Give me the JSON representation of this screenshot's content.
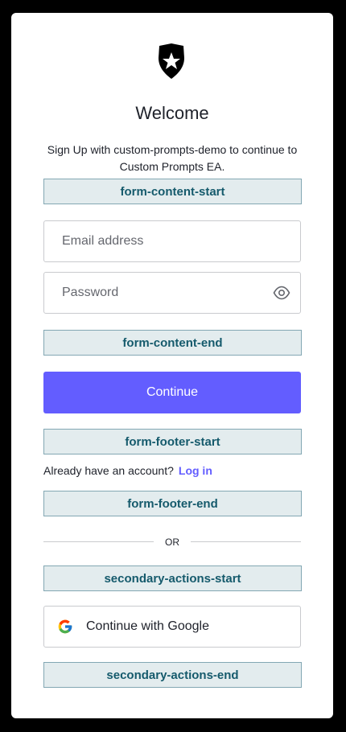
{
  "header": {
    "title": "Welcome",
    "subtitle": "Sign Up with custom-prompts-demo to continue to Custom Prompts EA."
  },
  "markers": {
    "form_content_start": "form-content-start",
    "form_content_end": "form-content-end",
    "form_footer_start": "form-footer-start",
    "form_footer_end": "form-footer-end",
    "secondary_actions_start": "secondary-actions-start",
    "secondary_actions_end": "secondary-actions-end"
  },
  "form": {
    "email_placeholder": "Email address",
    "email_value": "",
    "password_placeholder": "Password",
    "password_value": "",
    "continue_label": "Continue"
  },
  "footer": {
    "prompt": "Already have an account?",
    "login_label": "Log in"
  },
  "divider": {
    "label": "OR"
  },
  "social": {
    "google_label": "Continue with Google"
  },
  "colors": {
    "primary": "#635dff",
    "marker_bg": "#e3ecee",
    "marker_text": "#155a6c",
    "text": "#1e212a"
  },
  "icons": {
    "logo": "shield-logo-icon",
    "password_toggle": "eye-icon",
    "google": "google-icon"
  }
}
